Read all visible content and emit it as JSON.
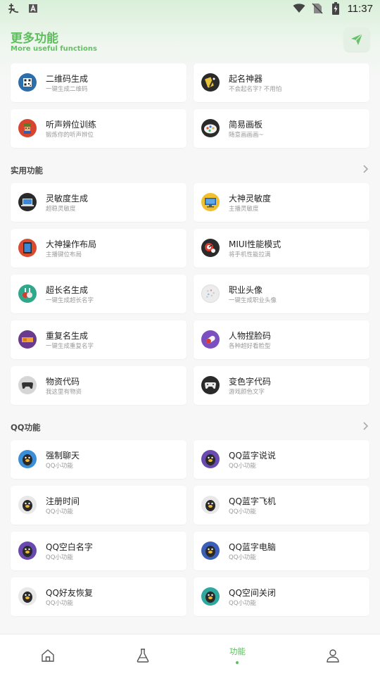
{
  "status_bar": {
    "time": "11:37",
    "icons": [
      "notification-app-icon",
      "notification-a-icon",
      "wifi-icon",
      "no-sim-icon",
      "battery-charging-icon"
    ]
  },
  "header": {
    "title": "更多功能",
    "subtitle": "More useful functions",
    "action_icon": "send-icon"
  },
  "top_cards": [
    {
      "title": "二维码生成",
      "sub": "一键生成二维码",
      "icon": "qr-code-icon"
    },
    {
      "title": "起名神器",
      "sub": "不会起名字? 不用怕",
      "icon": "magic-wand-icon"
    },
    {
      "title": "听声辨位训练",
      "sub": "锻炼你的听声辨位",
      "icon": "soldier-icon"
    },
    {
      "title": "简易画板",
      "sub": "随意画画画~",
      "icon": "palette-icon"
    }
  ],
  "sections": [
    {
      "title": "实用功能",
      "items": [
        {
          "title": "灵敏度生成",
          "sub": "超稳灵敏度",
          "icon": "laptop-icon"
        },
        {
          "title": "大神灵敏度",
          "sub": "主播灵敏度",
          "icon": "monitor-icon"
        },
        {
          "title": "大神操作布局",
          "sub": "主播键位布局",
          "icon": "tablet-icon"
        },
        {
          "title": "MIUI性能模式",
          "sub": "将手机性能拉满",
          "icon": "speed-gauge-icon"
        },
        {
          "title": "超长名生成",
          "sub": "一键生成超长名字",
          "icon": "potion-icon"
        },
        {
          "title": "职业头像",
          "sub": "一键生成职业头像",
          "icon": "dots-avatar-icon"
        },
        {
          "title": "重复名生成",
          "sub": "一键生成重复名字",
          "icon": "ticket-icon"
        },
        {
          "title": "人物捏脸码",
          "sub": "各种超好看脸型",
          "icon": "pill-icon"
        },
        {
          "title": "物资代码",
          "sub": "我这里有物资",
          "icon": "gamepad-icon"
        },
        {
          "title": "变色字代码",
          "sub": "游戏颜色文字",
          "icon": "gamepad-dark-icon"
        }
      ]
    },
    {
      "title": "QQ功能",
      "items": [
        {
          "title": "强制聊天",
          "sub": "QQ小功能",
          "icon": "qq-penguin-icon"
        },
        {
          "title": "QQ蓝字说说",
          "sub": "QQ小功能",
          "icon": "qq-penguin-icon"
        },
        {
          "title": "注册时间",
          "sub": "QQ小功能",
          "icon": "qq-penguin-icon"
        },
        {
          "title": "QQ蓝字飞机",
          "sub": "QQ小功能",
          "icon": "qq-penguin-icon"
        },
        {
          "title": "QQ空白名字",
          "sub": "QQ小功能",
          "icon": "qq-penguin-icon"
        },
        {
          "title": "QQ蓝字电脑",
          "sub": "QQ小功能",
          "icon": "qq-penguin-icon"
        },
        {
          "title": "QQ好友恢复",
          "sub": "QQ小功能",
          "icon": "qq-penguin-icon"
        },
        {
          "title": "QQ空间关闭",
          "sub": "QQ小功能",
          "icon": "qq-penguin-icon"
        }
      ]
    }
  ],
  "bottom_nav": [
    {
      "id": "home",
      "icon": "home-icon",
      "label": ""
    },
    {
      "id": "lab",
      "icon": "flask-icon",
      "label": ""
    },
    {
      "id": "functions",
      "icon": "",
      "label": "功能",
      "active": true
    },
    {
      "id": "profile",
      "icon": "user-icon",
      "label": ""
    }
  ],
  "colors": {
    "accent": "#5cbf5c",
    "background": "#f6f7f6",
    "card": "#ffffff"
  }
}
